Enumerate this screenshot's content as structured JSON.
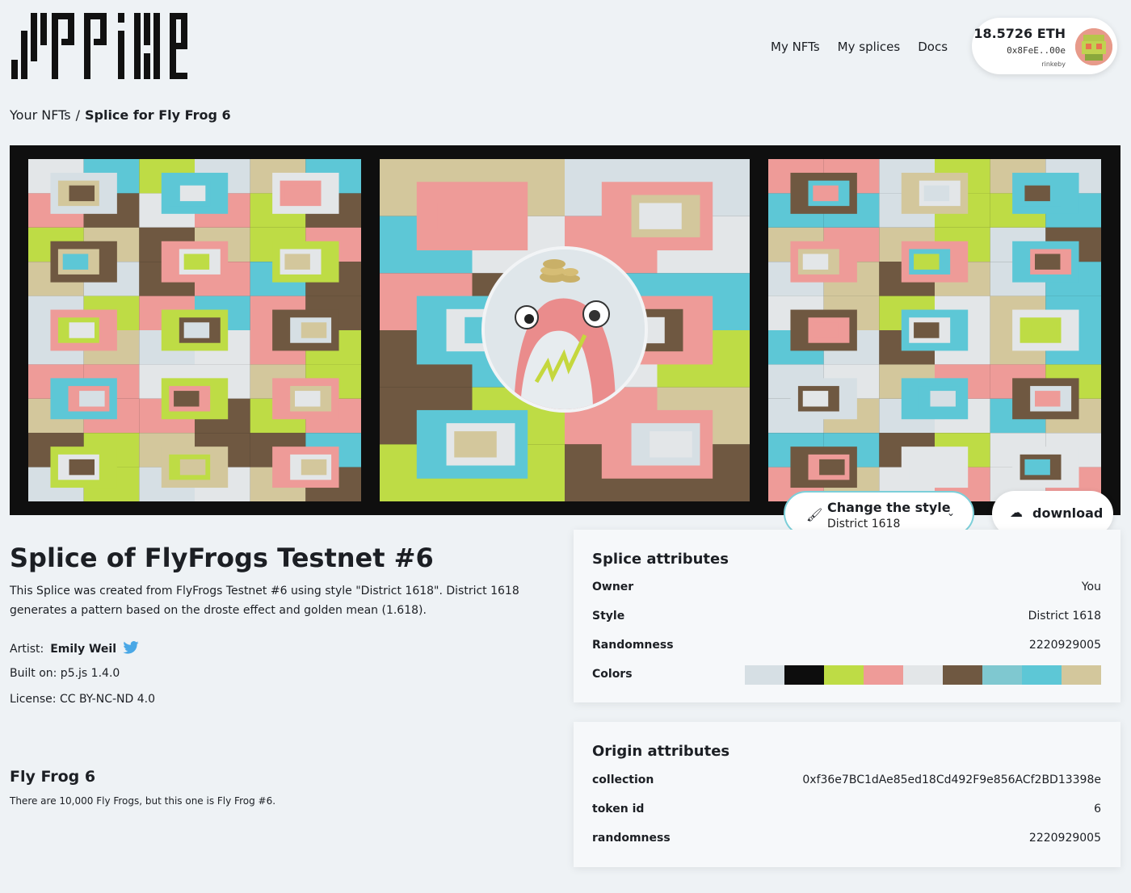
{
  "nav": {
    "links": [
      "My NFTs",
      "My splices",
      "Docs"
    ]
  },
  "wallet": {
    "balance": "18.5726 ETH",
    "address": "0x8FeE..00e",
    "network": "rinkeby"
  },
  "breadcrumb": {
    "parent": "Your NFTs",
    "separator": "/",
    "current": "Splice for Fly Frog 6"
  },
  "style_button": {
    "label": "Change the style",
    "value": "District 1618"
  },
  "download_button": {
    "label": "download"
  },
  "splice": {
    "title": "Splice of FlyFrogs Testnet #6",
    "description": "This Splice was created from FlyFrogs Testnet #6 using style \"District 1618\". District 1618 generates a pattern based on the droste effect and golden mean (1.618).",
    "artist_label": "Artist:",
    "artist_name": "Emily Weil",
    "built_on": "Built on: p5.js 1.4.0",
    "license": "License: CC BY-NC-ND 4.0"
  },
  "origin": {
    "title": "Fly Frog 6",
    "description": "There are 10,000 Fly Frogs, but this one is Fly Frog #6."
  },
  "splice_attributes": {
    "title": "Splice attributes",
    "owner_label": "Owner",
    "owner": "You",
    "style_label": "Style",
    "style": "District 1618",
    "randomness_label": "Randomness",
    "randomness": "2220929005",
    "colors_label": "Colors",
    "colors": [
      "#d6dfe4",
      "#0d0d0d",
      "#bedc45",
      "#ee9b98",
      "#e3e6e8",
      "#6f5841",
      "#7fc8d0",
      "#5dc7d6",
      "#d3c79c"
    ]
  },
  "origin_attributes": {
    "title": "Origin attributes",
    "collection_label": "collection",
    "collection": "0xf36e7BC1dAe85ed18Cd492F9e856ACf2BD13398e",
    "token_label": "token id",
    "token_id": "6",
    "randomness_label": "randomness",
    "randomness": "2220929005"
  }
}
